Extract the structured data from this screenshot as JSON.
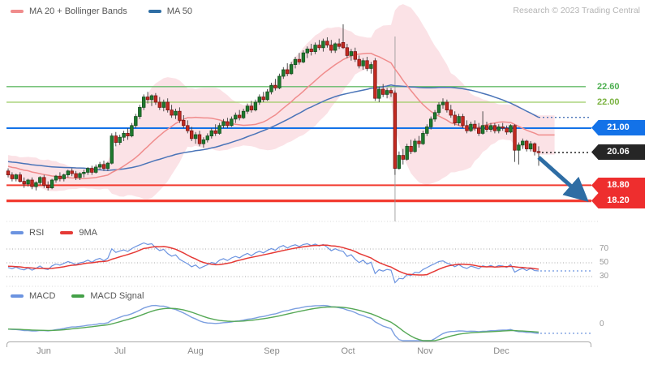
{
  "header": {
    "research": "Research © 2023 Trading Central"
  },
  "legends": {
    "main": [
      {
        "label": "MA 20 + Bollinger Bands",
        "color": "#f08c8c"
      },
      {
        "label": "MA 50",
        "color": "#2e6da4"
      }
    ],
    "rsi": [
      {
        "label": "RSI",
        "color": "#6b93e0"
      },
      {
        "label": "9MA",
        "color": "#e53935"
      }
    ],
    "macd": [
      {
        "label": "MACD",
        "color": "#6b93e0"
      },
      {
        "label": "MACD Signal",
        "color": "#43a047"
      }
    ]
  },
  "colors": {
    "candle_up": "#1e7a2e",
    "candle_up_border": "#14501f",
    "candle_down": "#c32a20",
    "candle_down_border": "#7e1414",
    "wick": "#3d3d3d",
    "ma20": "#f08c8c",
    "ma50": "#4a74b8",
    "band_fill": "rgba(247,203,210,0.55)",
    "line_green_1": "#66bb6a",
    "line_green_2": "#9ccc65",
    "line_blue": "#1372e8",
    "badge_blue": "#1372e8",
    "badge_black": "#262626",
    "badge_red": "#ee2e2e",
    "line_red": "#f23b30",
    "rsi_line": "#6b93e0",
    "rsi_ma": "#e53935",
    "macd_line": "#7c9fe0",
    "macd_signal": "#55a855",
    "arrow": "#2e6da4",
    "gridline": "#aaaaaa",
    "separator": "#d8d8d8",
    "event_line": "#999999"
  },
  "chart_data": {
    "type": "candlestick",
    "title": "",
    "x_axis": {
      "months": [
        "Jun",
        "Jul",
        "Aug",
        "Sep",
        "Oct",
        "Nov",
        "Dec"
      ]
    },
    "y_levels": {
      "green_lines": [
        {
          "label": "22.60",
          "value": 22.6
        },
        {
          "label": "22.00",
          "value": 22.0
        }
      ],
      "blue_line": {
        "label": "21.00",
        "value": 21.0
      },
      "last_price": {
        "label": "20.06",
        "value": 20.06
      },
      "red_lines": [
        {
          "label": "18.80",
          "value": 18.8
        },
        {
          "label": "18.20",
          "value": 18.2
        }
      ]
    },
    "rsi_axis_labels": [
      "70",
      "50",
      "30"
    ],
    "macd_axis_label": "0",
    "annotation_arrow": {
      "direction": "down-right",
      "target_level": 18.2,
      "color": "#2e6da4"
    },
    "indicators": [
      "MA 20",
      "MA 50",
      "Bollinger Bands",
      "RSI",
      "9MA",
      "MACD",
      "MACD Signal"
    ],
    "seed_closes": [
      20.4,
      20.1,
      20.5,
      20.2,
      19.9,
      20.3,
      20.0,
      19.7,
      20.1,
      19.8,
      19.5,
      19.9,
      19.6,
      19.95,
      19.65,
      19.35,
      19.75,
      19.45,
      19.8,
      19.5,
      19.2,
      19.6,
      19.3,
      19.65,
      19.4,
      19.7,
      19.45,
      19.25,
      19.55,
      19.35
    ],
    "ohlc": [
      [
        19.35,
        19.45,
        19.1,
        19.2
      ],
      [
        19.2,
        19.3,
        18.95,
        19.05
      ],
      [
        19.05,
        19.25,
        18.95,
        19.2
      ],
      [
        19.2,
        19.3,
        18.9,
        18.95
      ],
      [
        18.95,
        19.1,
        18.7,
        18.85
      ],
      [
        18.85,
        19.05,
        18.75,
        19.0
      ],
      [
        19.0,
        19.1,
        18.65,
        18.75
      ],
      [
        18.75,
        18.95,
        18.6,
        18.9
      ],
      [
        18.9,
        19.15,
        18.8,
        19.1
      ],
      [
        19.1,
        19.2,
        18.7,
        18.8
      ],
      [
        18.8,
        18.95,
        18.6,
        18.7
      ],
      [
        18.7,
        19.05,
        18.65,
        19.0
      ],
      [
        19.0,
        19.2,
        18.9,
        19.15
      ],
      [
        19.15,
        19.3,
        18.95,
        19.05
      ],
      [
        19.05,
        19.25,
        18.95,
        19.2
      ],
      [
        19.2,
        19.4,
        19.1,
        19.35
      ],
      [
        19.35,
        19.45,
        19.15,
        19.25
      ],
      [
        19.25,
        19.35,
        19.0,
        19.1
      ],
      [
        19.1,
        19.3,
        19.0,
        19.25
      ],
      [
        19.25,
        19.4,
        19.1,
        19.3
      ],
      [
        19.3,
        19.5,
        19.2,
        19.45
      ],
      [
        19.45,
        19.55,
        19.2,
        19.3
      ],
      [
        19.3,
        19.6,
        19.25,
        19.5
      ],
      [
        19.5,
        19.7,
        19.4,
        19.6
      ],
      [
        19.6,
        19.75,
        19.35,
        19.45
      ],
      [
        19.45,
        19.7,
        19.35,
        19.65
      ],
      [
        19.65,
        20.8,
        19.6,
        20.7
      ],
      [
        20.7,
        20.85,
        20.3,
        20.45
      ],
      [
        20.45,
        20.75,
        20.35,
        20.65
      ],
      [
        20.65,
        20.9,
        20.5,
        20.8
      ],
      [
        20.8,
        21.0,
        20.55,
        20.7
      ],
      [
        20.7,
        21.2,
        20.65,
        21.1
      ],
      [
        21.1,
        21.55,
        21.0,
        21.45
      ],
      [
        21.45,
        21.9,
        21.35,
        21.8
      ],
      [
        21.8,
        22.3,
        21.7,
        22.2
      ],
      [
        22.2,
        22.4,
        21.95,
        22.1
      ],
      [
        22.1,
        22.3,
        21.85,
        22.25
      ],
      [
        22.25,
        22.35,
        21.9,
        22.0
      ],
      [
        22.0,
        22.2,
        21.7,
        21.8
      ],
      [
        21.8,
        22.1,
        21.65,
        22.0
      ],
      [
        22.0,
        22.15,
        21.6,
        21.7
      ],
      [
        21.7,
        21.9,
        21.4,
        21.5
      ],
      [
        21.5,
        21.75,
        21.35,
        21.65
      ],
      [
        21.65,
        21.8,
        21.2,
        21.3
      ],
      [
        21.3,
        21.5,
        21.0,
        21.1
      ],
      [
        21.1,
        21.3,
        20.8,
        20.9
      ],
      [
        20.9,
        21.05,
        20.5,
        20.6
      ],
      [
        20.6,
        20.85,
        20.4,
        20.75
      ],
      [
        20.75,
        20.9,
        20.3,
        20.4
      ],
      [
        20.4,
        20.65,
        20.25,
        20.55
      ],
      [
        20.55,
        20.8,
        20.45,
        20.7
      ],
      [
        20.7,
        21.0,
        20.6,
        20.9
      ],
      [
        20.9,
        21.15,
        20.7,
        20.8
      ],
      [
        20.8,
        21.2,
        20.75,
        21.1
      ],
      [
        21.1,
        21.35,
        21.0,
        21.25
      ],
      [
        21.25,
        21.4,
        21.0,
        21.1
      ],
      [
        21.1,
        21.45,
        21.05,
        21.35
      ],
      [
        21.35,
        21.6,
        21.2,
        21.5
      ],
      [
        21.5,
        21.7,
        21.3,
        21.4
      ],
      [
        21.4,
        21.75,
        21.35,
        21.65
      ],
      [
        21.65,
        21.95,
        21.55,
        21.85
      ],
      [
        21.85,
        22.05,
        21.6,
        21.7
      ],
      [
        21.7,
        22.1,
        21.65,
        22.0
      ],
      [
        22.0,
        22.3,
        21.9,
        22.2
      ],
      [
        22.2,
        22.4,
        22.0,
        22.1
      ],
      [
        22.1,
        22.5,
        22.05,
        22.4
      ],
      [
        22.4,
        22.75,
        22.3,
        22.65
      ],
      [
        22.65,
        22.9,
        22.45,
        22.55
      ],
      [
        22.55,
        23.1,
        22.5,
        23.0
      ],
      [
        23.0,
        23.35,
        22.9,
        23.25
      ],
      [
        23.25,
        23.5,
        23.0,
        23.1
      ],
      [
        23.1,
        23.55,
        23.05,
        23.45
      ],
      [
        23.45,
        23.75,
        23.3,
        23.65
      ],
      [
        23.65,
        23.9,
        23.45,
        23.55
      ],
      [
        23.55,
        24.0,
        23.5,
        23.9
      ],
      [
        23.9,
        24.15,
        23.7,
        24.05
      ],
      [
        24.05,
        24.25,
        23.8,
        23.95
      ],
      [
        23.95,
        24.3,
        23.85,
        24.2
      ],
      [
        24.2,
        24.4,
        24.0,
        24.1
      ],
      [
        24.1,
        24.45,
        23.95,
        24.35
      ],
      [
        24.35,
        24.5,
        24.1,
        24.2
      ],
      [
        24.2,
        24.4,
        23.9,
        24.0
      ],
      [
        24.0,
        24.3,
        23.9,
        24.25
      ],
      [
        24.25,
        24.45,
        24.05,
        24.15
      ],
      [
        24.3,
        25.0,
        24.05,
        24.1
      ],
      [
        24.1,
        24.25,
        23.7,
        23.8
      ],
      [
        23.8,
        24.05,
        23.6,
        23.95
      ],
      [
        23.95,
        24.1,
        23.55,
        23.65
      ],
      [
        23.65,
        23.8,
        23.3,
        23.4
      ],
      [
        23.4,
        23.7,
        23.25,
        23.6
      ],
      [
        23.6,
        23.75,
        23.2,
        23.3
      ],
      [
        23.3,
        23.55,
        23.1,
        23.45
      ],
      [
        23.6,
        23.7,
        22.05,
        22.15
      ],
      [
        22.15,
        22.6,
        22.0,
        22.5
      ],
      [
        22.5,
        22.7,
        22.2,
        22.3
      ],
      [
        22.3,
        22.55,
        22.15,
        22.45
      ],
      [
        22.45,
        22.55,
        22.2,
        22.35
      ],
      [
        22.35,
        22.45,
        19.2,
        19.45
      ],
      [
        19.45,
        20.1,
        19.4,
        19.95
      ],
      [
        19.95,
        20.2,
        19.6,
        19.8
      ],
      [
        19.8,
        20.4,
        19.75,
        20.3
      ],
      [
        20.3,
        20.55,
        20.0,
        20.1
      ],
      [
        20.1,
        20.6,
        20.05,
        20.5
      ],
      [
        20.5,
        20.7,
        20.25,
        20.4
      ],
      [
        20.4,
        20.9,
        20.35,
        20.8
      ],
      [
        20.8,
        21.15,
        20.7,
        21.05
      ],
      [
        21.05,
        21.45,
        20.95,
        21.35
      ],
      [
        21.35,
        21.7,
        21.25,
        21.6
      ],
      [
        21.6,
        22.0,
        21.5,
        21.9
      ],
      [
        21.9,
        22.15,
        21.75,
        22.0
      ],
      [
        22.0,
        22.1,
        21.6,
        21.7
      ],
      [
        21.7,
        21.9,
        21.4,
        21.5
      ],
      [
        21.5,
        21.65,
        21.1,
        21.2
      ],
      [
        21.2,
        21.55,
        21.1,
        21.45
      ],
      [
        21.45,
        21.55,
        21.0,
        21.1
      ],
      [
        21.1,
        21.3,
        20.8,
        20.9
      ],
      [
        20.9,
        21.25,
        20.85,
        21.15
      ],
      [
        21.15,
        21.3,
        20.9,
        21.0
      ],
      [
        21.0,
        21.2,
        20.7,
        20.8
      ],
      [
        20.8,
        21.65,
        20.75,
        21.1
      ],
      [
        21.1,
        21.25,
        20.85,
        20.95
      ],
      [
        20.95,
        21.2,
        20.85,
        21.1
      ],
      [
        21.1,
        21.2,
        20.8,
        20.9
      ],
      [
        20.9,
        21.15,
        20.8,
        21.05
      ],
      [
        21.05,
        21.2,
        20.9,
        21.0
      ],
      [
        21.0,
        21.1,
        20.75,
        20.85
      ],
      [
        20.85,
        21.15,
        20.8,
        21.1
      ],
      [
        21.1,
        21.15,
        19.7,
        20.15
      ],
      [
        20.15,
        20.45,
        19.6,
        20.35
      ],
      [
        20.35,
        20.6,
        20.2,
        20.5
      ],
      [
        20.5,
        20.55,
        20.1,
        20.2
      ],
      [
        20.2,
        20.5,
        20.1,
        20.4
      ],
      [
        20.4,
        20.45,
        19.95,
        20.1
      ],
      [
        20.1,
        20.3,
        19.55,
        20.06
      ]
    ]
  }
}
